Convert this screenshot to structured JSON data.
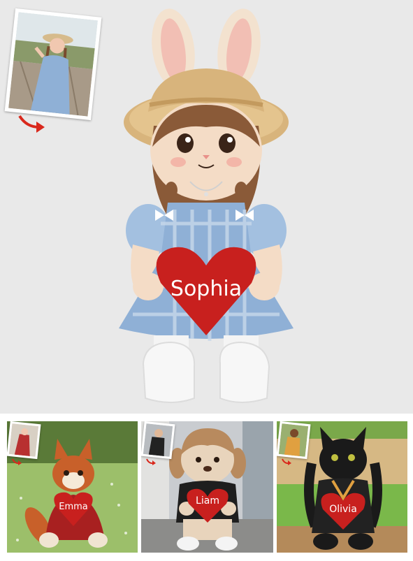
{
  "hero": {
    "name_label": "Sophia",
    "alt": "Custom plush doll made from a photo of a girl in a blue gingham dress and straw hat with bunny ears"
  },
  "thumbnails": [
    {
      "name_label": "Emma"
    },
    {
      "name_label": "Liam"
    },
    {
      "name_label": "Olivia"
    }
  ],
  "colors": {
    "background": "#e9e9e9",
    "heart": "#c8201e",
    "gingham": "#8fb0d6",
    "hat": "#d8b47c"
  }
}
